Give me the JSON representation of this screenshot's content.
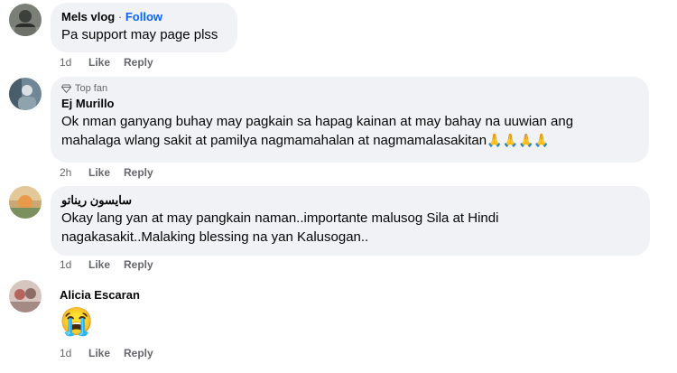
{
  "comments": [
    {
      "author": "Mels vlog",
      "separator": "·",
      "follow_label": "Follow",
      "text": "Pa support may page plss",
      "time": "1d",
      "like_label": "Like",
      "reply_label": "Reply"
    },
    {
      "badge": "Top fan",
      "author": "Ej Murillo",
      "text_line1": "Ok nman ganyang buhay may pagkain sa hapag kainan at may bahay na uuwian ang",
      "text_line2": "mahalaga wlang sakit at pamilya nagmamahalan at nagmamalasakitan",
      "emoji": "🙏🙏🙏🙏",
      "time": "2h",
      "like_label": "Like",
      "reply_label": "Reply"
    },
    {
      "author": "سايسون ريناتو",
      "text_line1": "Okay lang yan at may pangkain naman..importante malusog Sila at Hindi",
      "text_line2": "nagakasakit..Malaking blessing na yan Kalusogan..",
      "time": "1d",
      "like_label": "Like",
      "reply_label": "Reply"
    },
    {
      "author": "Alicia Escaran",
      "emoji": "😭",
      "time": "1d",
      "like_label": "Like",
      "reply_label": "Reply"
    }
  ]
}
